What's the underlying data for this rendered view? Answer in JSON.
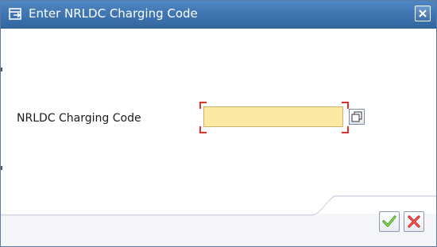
{
  "dialog": {
    "title": "Enter NRLDC Charging Code",
    "title_icon": "dialog-enter-icon",
    "close_icon": "close-icon"
  },
  "form": {
    "label": "NRLDC Charging Code",
    "value": "",
    "placeholder": "",
    "required": true,
    "help_icon": "value-help-icon"
  },
  "footer": {
    "ok_icon": "checkmark-icon",
    "cancel_icon": "cancel-x-icon"
  },
  "colors": {
    "titlebar": "#3f75b2",
    "input_bg": "#fbe9a2",
    "required_marker": "#e0302a",
    "ok_green": "#3aa12a",
    "cancel_red": "#d42020"
  }
}
